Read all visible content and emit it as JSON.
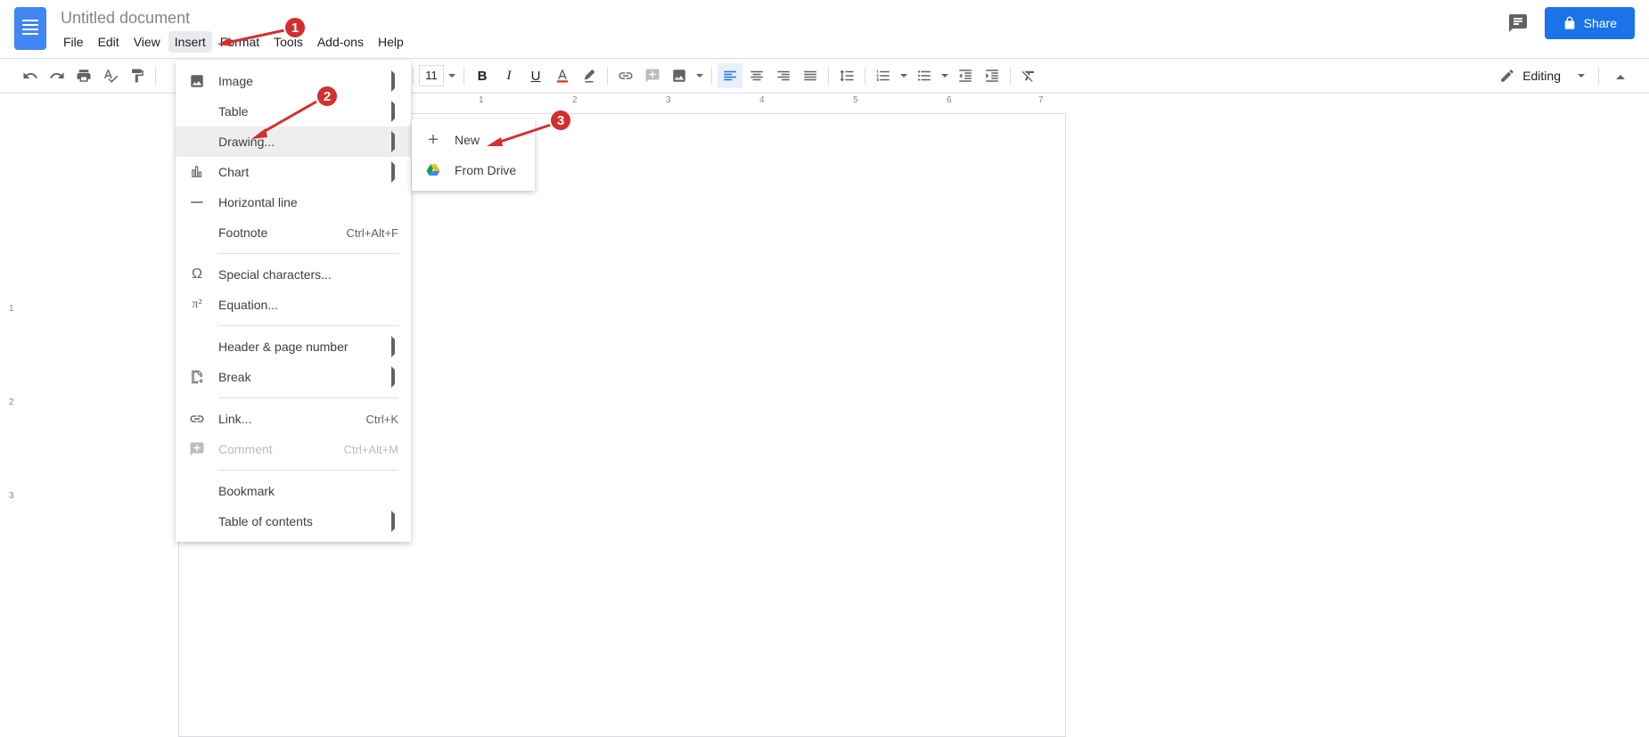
{
  "doc_title": "Untitled document",
  "menubar": {
    "file": "File",
    "edit": "Edit",
    "view": "View",
    "insert": "Insert",
    "format": "Format",
    "tools": "Tools",
    "addons": "Add-ons",
    "help": "Help"
  },
  "share_label": "Share",
  "toolbar": {
    "font_size": "11",
    "editing": "Editing"
  },
  "ruler_numbers": [
    "1",
    "2",
    "3",
    "4",
    "5",
    "6",
    "7"
  ],
  "vruler_numbers": [
    "1",
    "2",
    "3"
  ],
  "insert_menu": {
    "image": "Image",
    "table": "Table",
    "drawing": "Drawing...",
    "chart": "Chart",
    "horizontal_line": "Horizontal line",
    "footnote": "Footnote",
    "footnote_shortcut": "Ctrl+Alt+F",
    "special_characters": "Special characters...",
    "equation": "Equation...",
    "header_page_number": "Header & page number",
    "break": "Break",
    "link": "Link...",
    "link_shortcut": "Ctrl+K",
    "comment": "Comment",
    "comment_shortcut": "Ctrl+Alt+M",
    "bookmark": "Bookmark",
    "toc": "Table of contents"
  },
  "submenu": {
    "new": "New",
    "from_drive": "From Drive"
  },
  "callouts": {
    "c1": "1",
    "c2": "2",
    "c3": "3"
  }
}
